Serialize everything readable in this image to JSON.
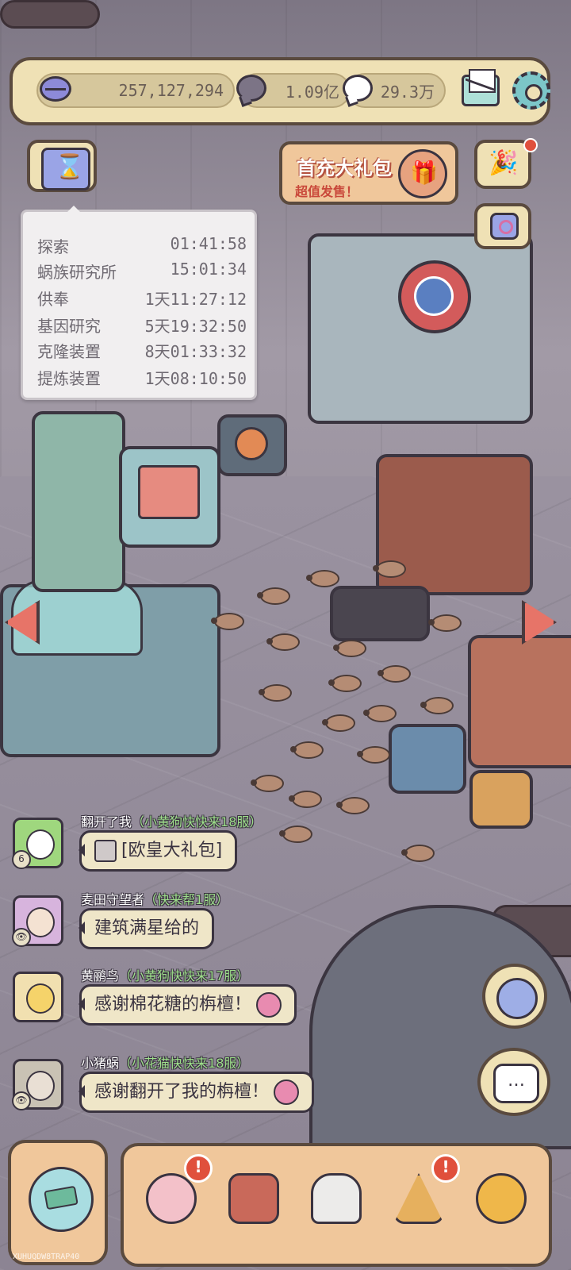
{
  "top_bar": {
    "gems": "257,127,294",
    "gray_currency": "1.09亿",
    "white_currency": "29.3万"
  },
  "promo": {
    "title": "首充大礼包",
    "subtitle": "超值发售！"
  },
  "timers": [
    {
      "label": "探索",
      "value": "01:41:58"
    },
    {
      "label": "蜗族研究所",
      "value": "15:01:34"
    },
    {
      "label": "供奉",
      "value": "1天11:27:12"
    },
    {
      "label": "基因研究",
      "value": "5天19:32:50"
    },
    {
      "label": "克隆装置",
      "value": "8天01:33:32"
    },
    {
      "label": "提炼装置",
      "value": "1天08:10:50"
    }
  ],
  "chat": [
    {
      "name": "翻开了我",
      "server": "（小黄狗快快来18服）",
      "message": "[欧皇大礼包]"
    },
    {
      "name": "麦田守望者",
      "server": "（快来帮1服）",
      "message": "建筑满星给的"
    },
    {
      "name": "黄鹂鸟",
      "server": "（小黄狗快快来17服）",
      "message": "感谢棉花糖的栴檀！"
    },
    {
      "name": "小猪蜗",
      "server": "（小花猫快快来18服）",
      "message": "感谢翻开了我的栴檀！"
    }
  ],
  "avatar_badges": [
    "6",
    "👁",
    "",
    "👁"
  ],
  "nav_badges": [
    "!",
    "!"
  ],
  "version_tag": "XUHUQDW8TRAP40",
  "chat_button_glyph": "…",
  "colors": {
    "panel": "#efe1b5",
    "outline": "#5a4a3e",
    "accent_red": "#e0503c",
    "server_green": "#9fe08c"
  },
  "icons": [
    "gem-icon",
    "gray-bubble-icon",
    "white-bubble-icon",
    "mail-icon",
    "gear-icon",
    "hourglass-icon",
    "party-popper-icon",
    "quest-icon",
    "map-icon",
    "chat-icon",
    "snail-icon",
    "backpack-icon",
    "bust-icon",
    "pyramid-eye-icon",
    "key-coin-icon",
    "globe-icon"
  ]
}
